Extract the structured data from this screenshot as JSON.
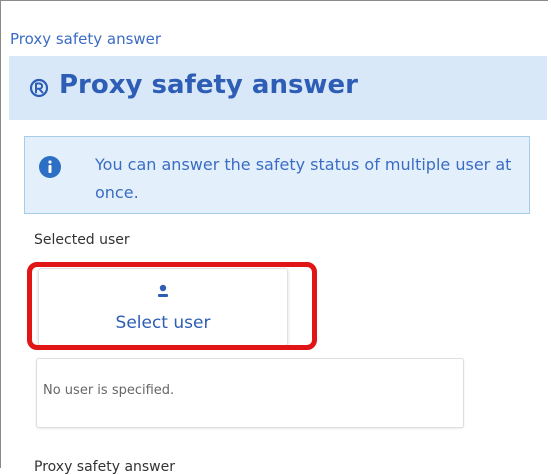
{
  "breadcrumb": "Proxy safety answer",
  "header": {
    "title": "Proxy safety answer",
    "icon": "proxy-answer-icon"
  },
  "notice": {
    "icon": "info-icon",
    "text": "You can answer the safety status of multiple user at once."
  },
  "selected_user": {
    "label": "Selected user",
    "button_label": "Select user",
    "button_icon": "person-icon",
    "empty_message": "No user is specified."
  },
  "next_section_label": "Proxy safety answer",
  "colors": {
    "accent": "#2d5db5",
    "header_bg": "#d8e8f8",
    "notice_bg": "#e3f0fb",
    "highlight": "#e11515"
  }
}
